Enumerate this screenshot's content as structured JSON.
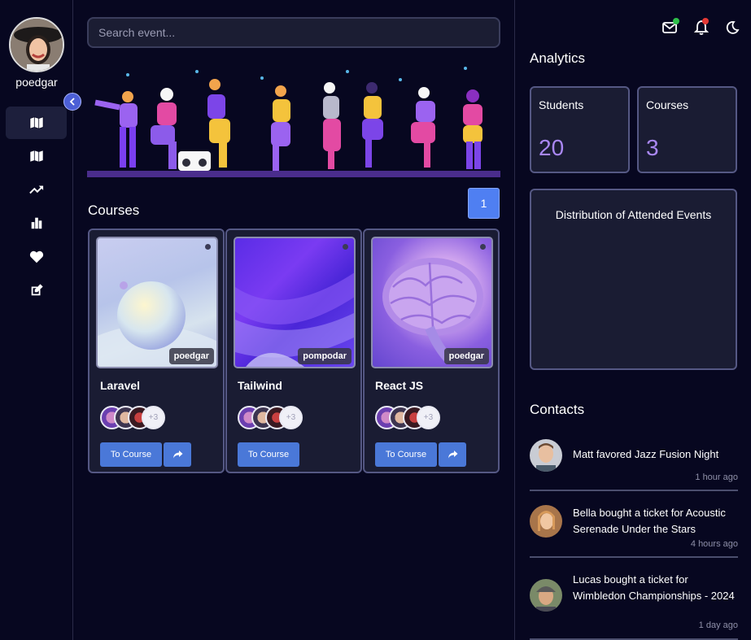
{
  "sidebar": {
    "username": "poedgar",
    "nav": [
      {
        "icon": "map-icon",
        "active": true
      },
      {
        "icon": "map-icon",
        "active": false
      },
      {
        "icon": "trending-up-icon",
        "active": false
      },
      {
        "icon": "bar-chart-icon",
        "active": false
      },
      {
        "icon": "heart-icon",
        "active": false
      },
      {
        "icon": "edit-icon",
        "active": false
      }
    ]
  },
  "search": {
    "placeholder": "Search event..."
  },
  "courses_section": {
    "title": "Courses",
    "page": "1",
    "cards": [
      {
        "title": "Laravel",
        "tag": "poedgar",
        "more": "+3",
        "button": "To Course"
      },
      {
        "title": "Tailwind",
        "tag": "pompodar",
        "more": "+3",
        "button": "To Course"
      },
      {
        "title": "React JS",
        "tag": "poedgar",
        "more": "+3",
        "button": "To Course"
      }
    ]
  },
  "analytics": {
    "title": "Analytics",
    "students": {
      "label": "Students",
      "value": "20"
    },
    "courses": {
      "label": "Courses",
      "value": "3"
    },
    "distribution_title": "Distribution of Attended Events"
  },
  "contacts": {
    "title": "Contacts",
    "items": [
      {
        "text": "Matt favored Jazz Fusion Night",
        "time": "1 hour ago"
      },
      {
        "text": "Bella bought a ticket for Acoustic Serenade Under the Stars",
        "time": "4 hours ago"
      },
      {
        "text": "Lucas bought a ticket for Wimbledon Championships - 2024",
        "time": "1 day ago"
      }
    ]
  },
  "colors": {
    "background": "#070720",
    "card": "#1a1c33",
    "accent": "#4a78d8",
    "stat_value": "#a987f3",
    "mail_badge": "#2fbf4a",
    "bell_badge": "#e53935"
  }
}
